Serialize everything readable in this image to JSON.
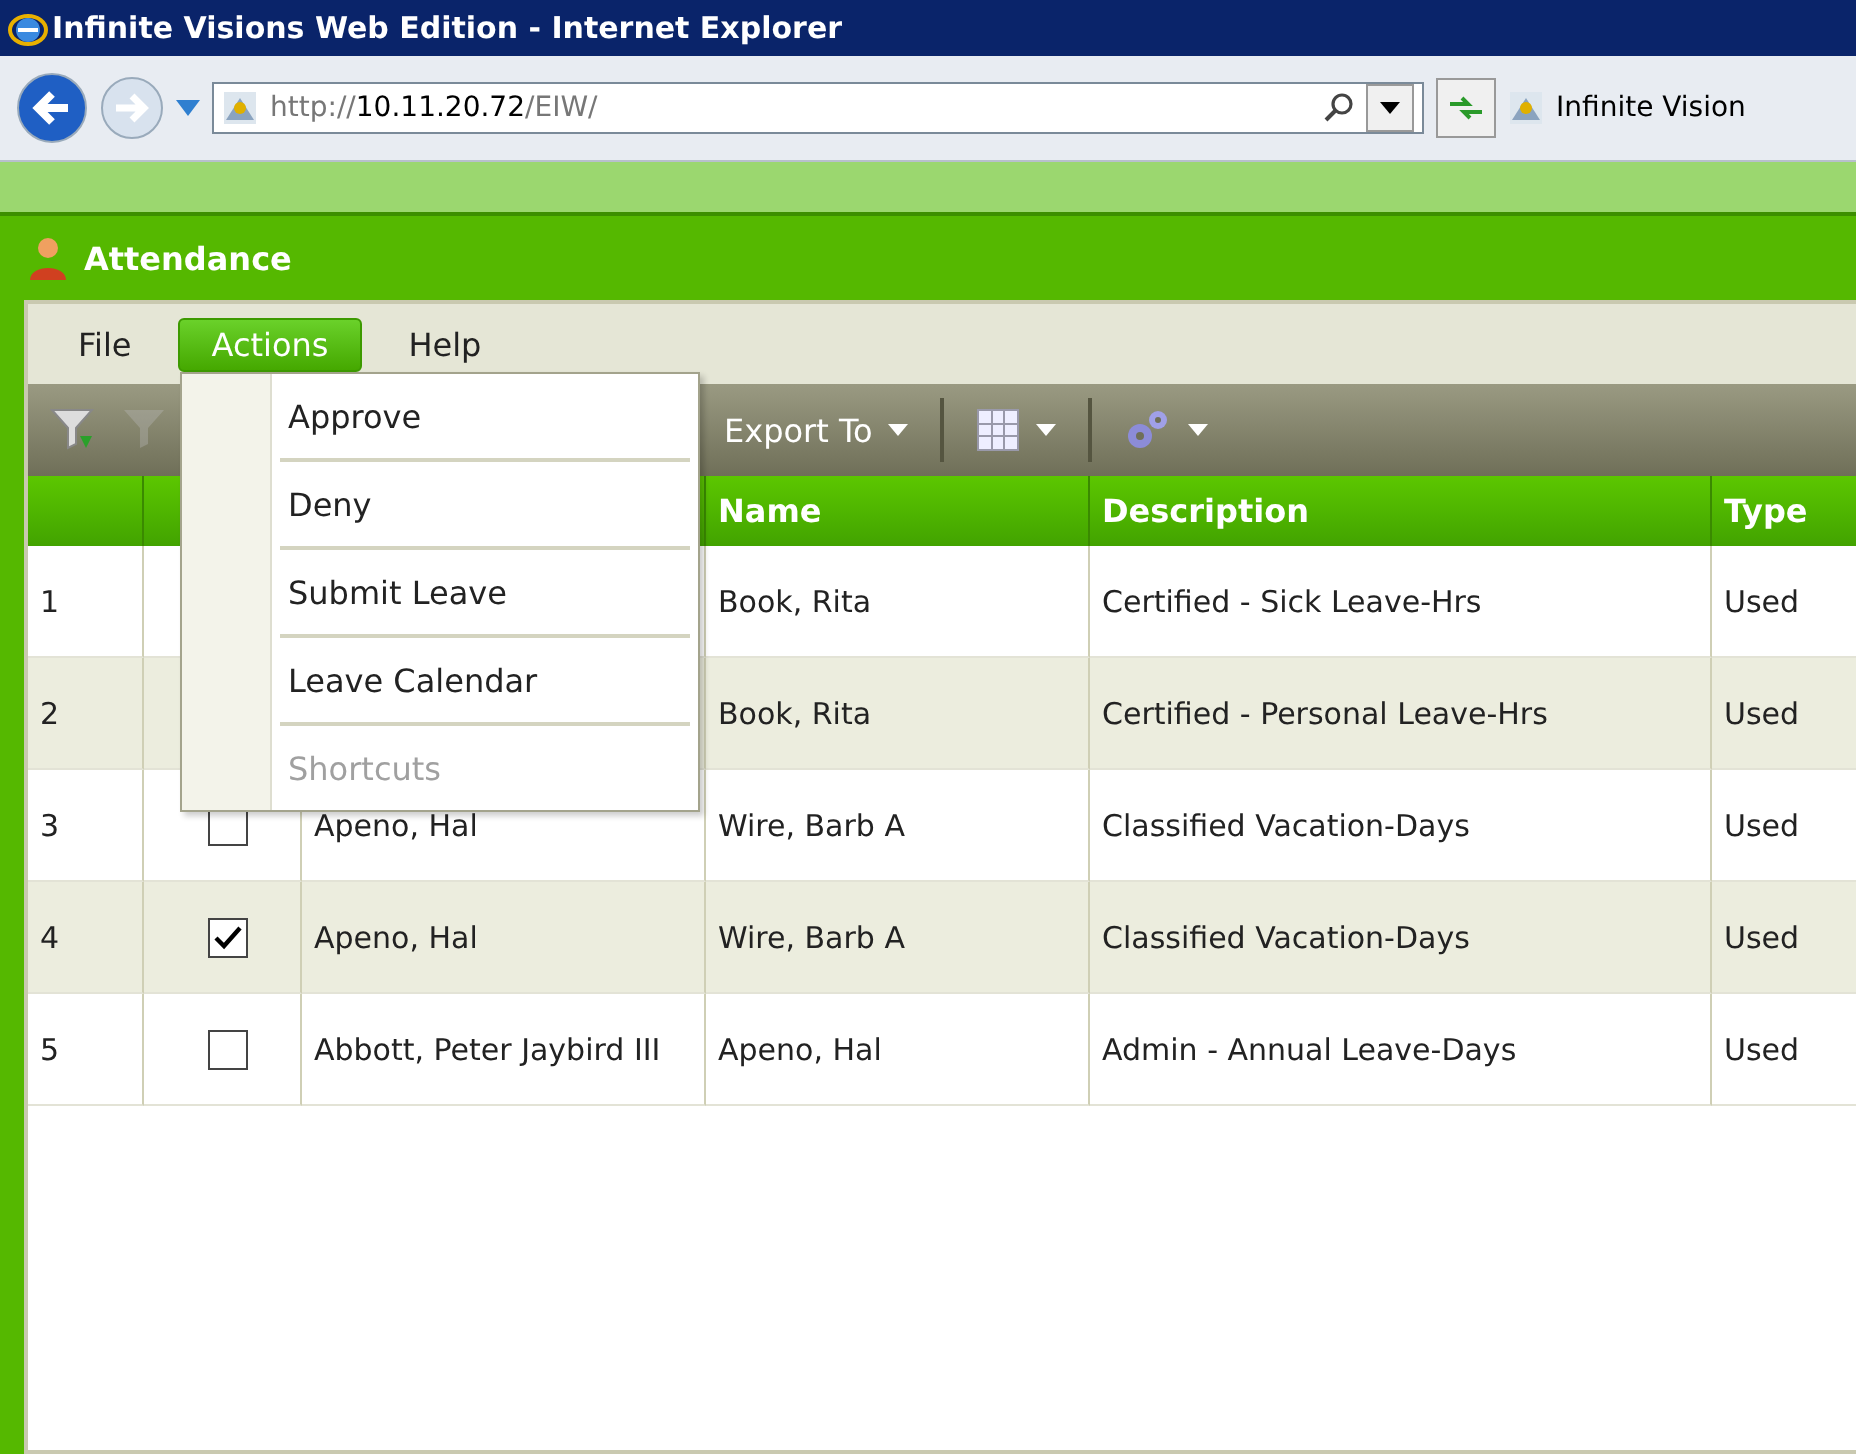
{
  "window": {
    "title": "Infinite Visions Web Edition - Internet Explorer"
  },
  "address_bar": {
    "url_prefix": "http://",
    "url_host": "10.11.20.72",
    "url_path": "/EIW/"
  },
  "browser_tab": {
    "title": "Infinite Vision"
  },
  "app": {
    "title": "Attendance"
  },
  "menu_bar": [
    {
      "label": "File",
      "selected": false
    },
    {
      "label": "Actions",
      "selected": true
    },
    {
      "label": "Help",
      "selected": false
    }
  ],
  "actions_menu": [
    {
      "label": "Approve",
      "disabled": false
    },
    {
      "label": "Deny",
      "disabled": false
    },
    {
      "label": "Submit Leave",
      "disabled": false
    },
    {
      "label": "Leave Calendar",
      "disabled": false
    },
    {
      "label": "Shortcuts",
      "disabled": true
    }
  ],
  "toolbar": {
    "export_label": "Export To"
  },
  "table": {
    "columns": [
      "Name",
      "Description",
      "Type"
    ],
    "rows": [
      {
        "number": "1",
        "name": "Book, Rita",
        "description": "Certified - Sick Leave-Hrs",
        "type": "Used"
      },
      {
        "number": "2",
        "name": "Book, Rita",
        "description": "Certified - Personal Leave-Hrs",
        "type": "Used"
      },
      {
        "number": "3",
        "checked": false,
        "requester": "Apeno, Hal",
        "name": "Wire, Barb A",
        "description": "Classified Vacation-Days",
        "type": "Used"
      },
      {
        "number": "4",
        "checked": true,
        "requester": "Apeno, Hal",
        "name": "Wire, Barb A",
        "description": "Classified Vacation-Days",
        "type": "Used"
      },
      {
        "number": "5",
        "checked": false,
        "requester": "Abbott, Peter Jaybird III",
        "name": "Apeno, Hal",
        "description": "Admin - Annual Leave-Days",
        "type": "Used"
      }
    ]
  }
}
